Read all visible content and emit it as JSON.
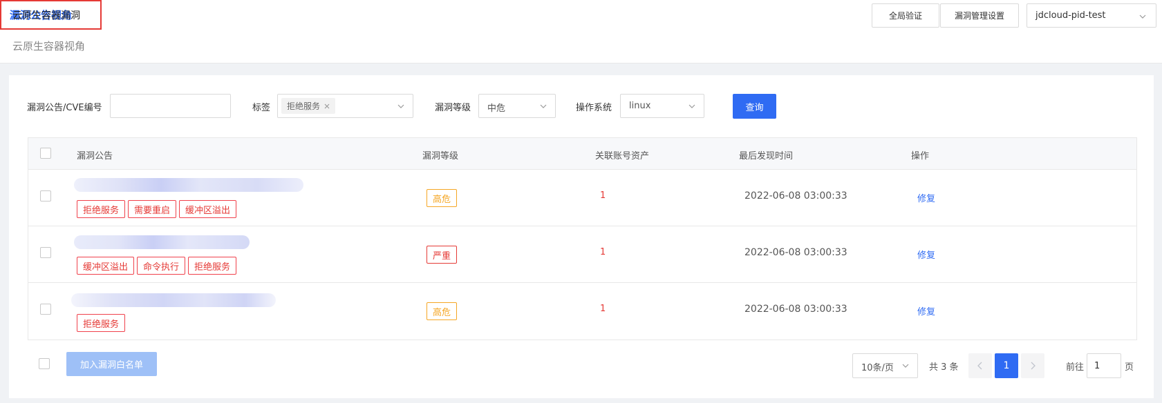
{
  "header": {
    "title": "云原生容器漏洞",
    "global_verify_label": "全局验证",
    "vuln_settings_label": "漏洞管理设置",
    "account_value": "jdcloud-pid-test"
  },
  "tabs": [
    {
      "label": "云原生容器视角",
      "active": false
    },
    {
      "label": "漏洞公告视角",
      "active": true
    }
  ],
  "filters": {
    "cve_label": "漏洞公告/CVE编号",
    "cve_value": "",
    "tag_label": "标签",
    "tag_selected": "拒绝服务",
    "level_label": "漏洞等级",
    "level_value": "中危",
    "os_label": "操作系统",
    "os_value": "linux",
    "query_label": "查询"
  },
  "table": {
    "columns": [
      "漏洞公告",
      "漏洞等级",
      "关联账号资产",
      "最后发现时间",
      "操作"
    ],
    "rows": [
      {
        "tags": [
          "拒绝服务",
          "需要重启",
          "缓冲区溢出"
        ],
        "level": "高危",
        "level_type": "high",
        "assets": "1",
        "last_seen": "2022-06-08 03:00:33",
        "action": "修复"
      },
      {
        "tags": [
          "缓冲区溢出",
          "命令执行",
          "拒绝服务"
        ],
        "level": "严重",
        "level_type": "critical",
        "assets": "1",
        "last_seen": "2022-06-08 03:00:33",
        "action": "修复"
      },
      {
        "tags": [
          "拒绝服务"
        ],
        "level": "高危",
        "level_type": "high",
        "assets": "1",
        "last_seen": "2022-06-08 03:00:33",
        "action": "修复"
      }
    ]
  },
  "footer": {
    "whitelist_label": "加入漏洞白名单",
    "page_size": "10条/页",
    "total": "共 3 条",
    "current_page": "1",
    "goto_label": "前往",
    "goto_value": "1",
    "goto_unit": "页"
  },
  "colors": {
    "primary": "#2f6bf3",
    "danger": "#e53935",
    "warning": "#f5a623"
  }
}
